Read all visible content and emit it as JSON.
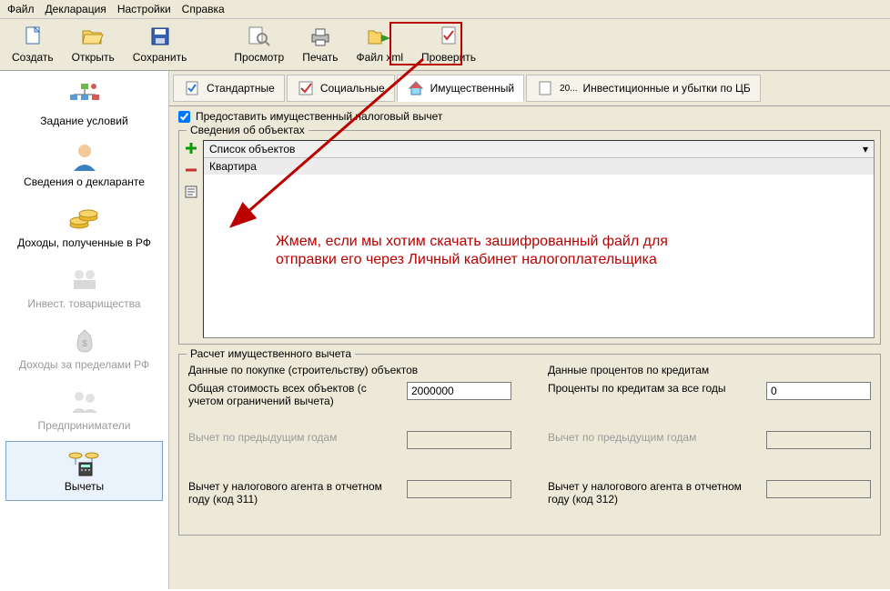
{
  "menu": {
    "file": "Файл",
    "decl": "Декларация",
    "settings": "Настройки",
    "help": "Справка"
  },
  "toolbar": {
    "create": "Создать",
    "open": "Открыть",
    "save": "Сохранить",
    "view": "Просмотр",
    "print": "Печать",
    "xml": "Файл xml",
    "check": "Проверить"
  },
  "sidebar": {
    "cond_label": "Задание условий",
    "decl_label": "Сведения о декларанте",
    "income_rf": "Доходы, полученные в РФ",
    "invest": "Инвест. товарищества",
    "abroad": "Доходы за пределами РФ",
    "entr": "Предприниматели",
    "ded": "Вычеты"
  },
  "tabs": {
    "std": "Стандартные",
    "soc": "Социальные",
    "prop": "Имущественный",
    "inv": "Инвестиционные и убытки по ЦБ"
  },
  "provide_label": "Предоставить имущественный налоговый вычет",
  "objects": {
    "group_title": "Сведения об объектах",
    "header": "Список объектов",
    "row1": "Квартира"
  },
  "annotation": {
    "l1": "Жмем, если мы хотим скачать зашифрованный файл для",
    "l2": "отправки его через Личный кабинет налогоплательщика"
  },
  "calc": {
    "group_title": "Расчет имущественного вычета",
    "left_head": "Данные по покупке (строительству) объектов",
    "right_head": "Данные процентов по кредитам",
    "total_cost_label": "Общая стоимость всех объектов (с учетом ограничений вычета)",
    "total_cost_value": "2000000",
    "interest_label": "Проценты по кредитам за все годы",
    "interest_value": "0",
    "prev_years": "Вычет по предыдущим годам",
    "agent311": "Вычет у налогового агента в отчетном году (код 311)",
    "agent312": "Вычет у налогового агента в отчетном году (код 312)"
  },
  "tab_doc_label": "20..."
}
